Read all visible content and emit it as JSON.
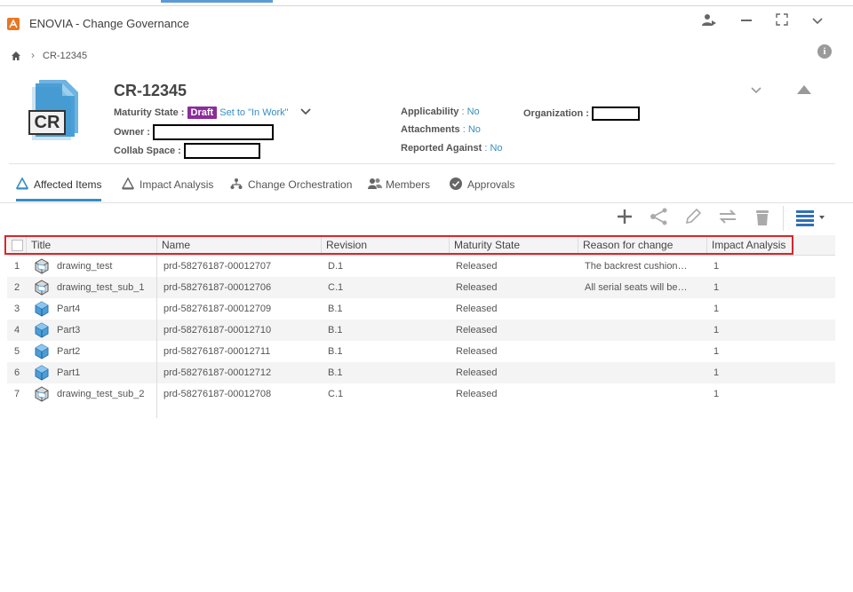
{
  "app": {
    "title": "ENOVIA - Change Governance"
  },
  "breadcrumb": {
    "current": "CR-12345"
  },
  "header": {
    "logo_text": "CR",
    "title": "CR-12345",
    "maturity_label": "Maturity State",
    "maturity_value": "Draft",
    "maturity_action": "Set to \"In Work\"",
    "owner_label": "Owner",
    "collab_label": "Collab Space",
    "applicability_label": "Applicability",
    "applicability_value": "No",
    "attachments_label": "Attachments",
    "attachments_value": "No",
    "reported_label": "Reported Against",
    "reported_value": "No",
    "organization_label": "Organization"
  },
  "tabs": [
    {
      "label": "Affected Items",
      "active": true
    },
    {
      "label": "Impact Analysis",
      "active": false
    },
    {
      "label": "Change Orchestration",
      "active": false
    },
    {
      "label": "Members",
      "active": false
    },
    {
      "label": "Approvals",
      "active": false
    }
  ],
  "grid": {
    "columns": [
      "Title",
      "Name",
      "Revision",
      "Maturity State",
      "Reason for change",
      "Impact Analysis"
    ],
    "rows": [
      {
        "n": "1",
        "title": "drawing_test",
        "kind": "drawing",
        "name": "prd-58276187-00012707",
        "revision": "D.1",
        "state": "Released",
        "reason": "The backrest cushion…",
        "impact": "1"
      },
      {
        "n": "2",
        "title": "drawing_test_sub_1",
        "kind": "drawing",
        "name": "prd-58276187-00012706",
        "revision": "C.1",
        "state": "Released",
        "reason": "All serial seats will be…",
        "impact": "1"
      },
      {
        "n": "3",
        "title": "Part4",
        "kind": "part",
        "name": "prd-58276187-00012709",
        "revision": "B.1",
        "state": "Released",
        "reason": "",
        "impact": "1"
      },
      {
        "n": "4",
        "title": "Part3",
        "kind": "part",
        "name": "prd-58276187-00012710",
        "revision": "B.1",
        "state": "Released",
        "reason": "",
        "impact": "1"
      },
      {
        "n": "5",
        "title": "Part2",
        "kind": "part",
        "name": "prd-58276187-00012711",
        "revision": "B.1",
        "state": "Released",
        "reason": "",
        "impact": "1"
      },
      {
        "n": "6",
        "title": "Part1",
        "kind": "part",
        "name": "prd-58276187-00012712",
        "revision": "B.1",
        "state": "Released",
        "reason": "",
        "impact": "1"
      },
      {
        "n": "7",
        "title": "drawing_test_sub_2",
        "kind": "drawing",
        "name": "prd-58276187-00012708",
        "revision": "C.1",
        "state": "Released",
        "reason": "",
        "impact": "1"
      }
    ]
  },
  "colors": {
    "accent": "#368ec4",
    "draft_badge": "#8b2d9a",
    "highlight": "#d9262c"
  }
}
